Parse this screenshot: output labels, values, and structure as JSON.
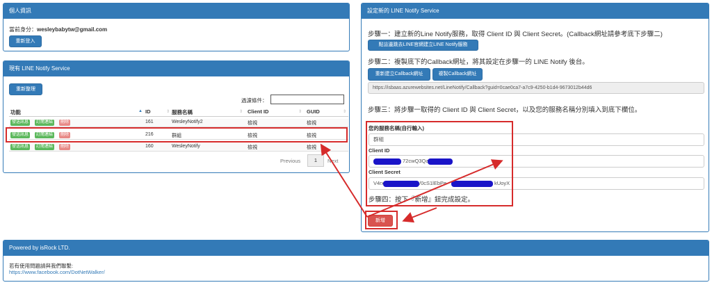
{
  "profile": {
    "title": "個人資訊",
    "identity_label": "當前身分：",
    "identity_value": "wesleybabytw@gmail.com",
    "relogin_button": "重新登入"
  },
  "services": {
    "title": "現有 LINE Notify Service",
    "reorganize_button": "重新整理",
    "filter_label": "過濾條件：",
    "filter_value": "",
    "columns": [
      "功能",
      "ID",
      "服務名稱",
      "Client ID",
      "GUID"
    ],
    "row_actions": [
      "發送訊息",
      "訂閱連結",
      "刪除"
    ],
    "rows": [
      {
        "id": "161",
        "name": "WesleyNotify2",
        "client_id": "檢視",
        "guid": "檢視"
      },
      {
        "id": "216",
        "name": "群組",
        "client_id": "檢視",
        "guid": "檢視"
      },
      {
        "id": "160",
        "name": "WesleyNotify",
        "client_id": "檢視",
        "guid": "檢視"
      }
    ],
    "pagination": {
      "previous": "Previous",
      "current": "1",
      "next": "Next"
    }
  },
  "setup": {
    "title": "設定新的 LINE Notify Service",
    "step1": "步驟一：建立新的Line Notify服務，取得 Client ID 與 Client Secret。(Callback網址請參考底下步驟二)",
    "step1_button": "點這邊跳去LINE官網建立LINE Notify服務",
    "step2": "步驟二：複製底下的Callback網址，將其設定在步驟一的 LINE Notify 後台。",
    "rebuild_callback_button": "重新建立Callback網址",
    "copy_callback_button": "複製Callback網址",
    "callback_url": "https://isbaas.azurewebsites.net/LineNotify/Callback?guid=0cae0ca7-a7c9-4250-b1d4-9673012b44d6",
    "step3": "步驟三：將步驟一取得的 Client ID 與 Client Secret，以及您的服務名稱分別填入到底下欄位。",
    "service_name_label": "您的服務名稱(自行輸入)",
    "service_name_value": "群組",
    "client_id_label": "Client ID",
    "client_id_visible": "72cwQ3Qa",
    "client_secret_label": "Client Secret",
    "client_secret_start": "V4rx",
    "client_secret_mid": "/0cS1lEbPe",
    "client_secret_end": "kUoyX",
    "step4": "步驟四：按下『新增』鈕完成設定。",
    "add_button": "新增"
  },
  "footer": {
    "title": "Powered by isRock LTD.",
    "contact_text": "若有使用問題請與我們聯繫:",
    "contact_link": "https://www.facebook.com/DotNetWalker/"
  },
  "colors": {
    "primary": "#337ab7",
    "success": "#5cb85c",
    "danger": "#d9534f",
    "annotation": "#d62b2b",
    "redaction": "#1a14c8"
  }
}
